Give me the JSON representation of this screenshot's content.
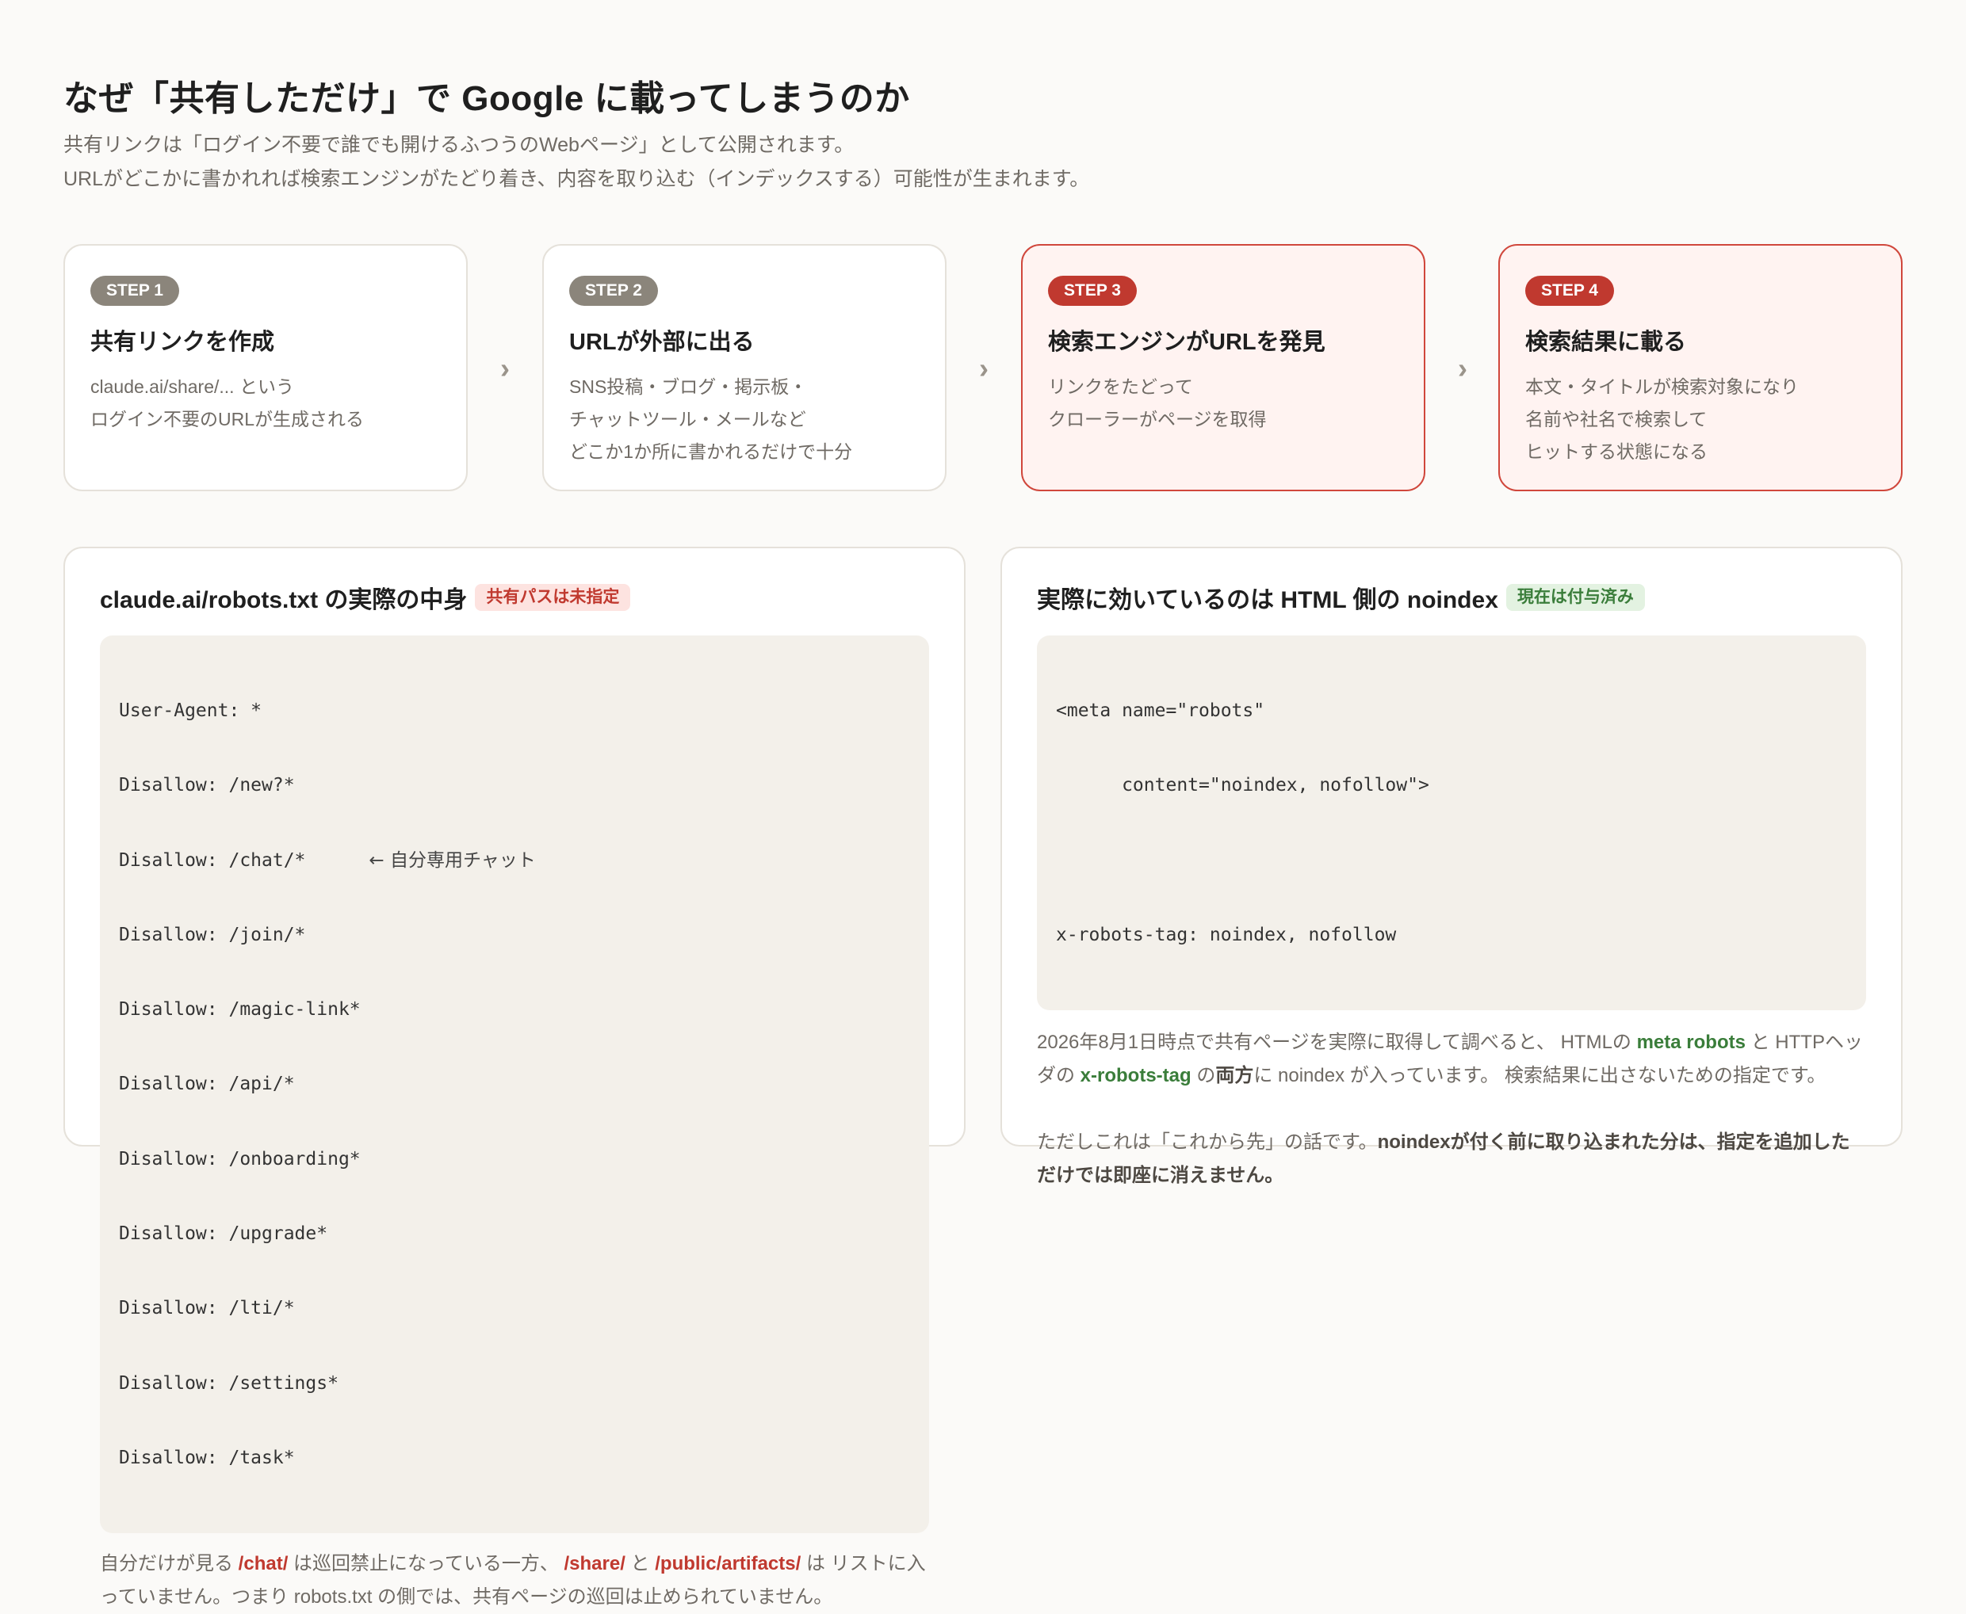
{
  "header": {
    "title": "なぜ「共有しただけ」で Google に載ってしまうのか",
    "subtitle_line1": "共有リンクは「ログイン不要で誰でも開けるふつうのWebページ」として公開されます。",
    "subtitle_line2": "URLがどこかに書かれれば検索エンジンがたどり着き、内容を取り込む（インデックスする）可能性が生まれます。"
  },
  "steps": [
    {
      "badge": "STEP 1",
      "title": "共有リンクを作成",
      "desc": [
        "claude.ai/share/... という",
        "ログイン不要のURLが生成される"
      ]
    },
    {
      "badge": "STEP 2",
      "title": "URLが外部に出る",
      "desc": [
        "SNS投稿・ブログ・掲示板・",
        "チャットツール・メールなど",
        "どこか1か所に書かれるだけで十分"
      ]
    },
    {
      "badge": "STEP 3",
      "title": "検索エンジンがURLを発見",
      "desc": [
        "リンクをたどって",
        "クローラーがページを取得"
      ]
    },
    {
      "badge": "STEP 4",
      "title": "検索結果に載る",
      "desc": [
        "本文・タイトルが検索対象になり",
        "名前や社名で検索して",
        "ヒットする状態になる"
      ]
    }
  ],
  "arrow_glyph": "›",
  "colors": {
    "accent_red": "#c0392f",
    "accent_green": "#3a7d3a",
    "badge_gray": "#8b857b"
  },
  "robots_panel": {
    "title": "claude.ai/robots.txt の実際の中身",
    "tag": "共有パスは未指定",
    "code": [
      "User-Agent: *",
      "Disallow: /new?*",
      "Disallow: /chat/*",
      "Disallow: /join/*",
      "Disallow: /magic-link*",
      "Disallow: /api/*",
      "Disallow: /onboarding*",
      "Disallow: /upgrade*",
      "Disallow: /lti/*",
      "Disallow: /settings*",
      "Disallow: /task*"
    ],
    "chat_note": "← 自分専用チャット",
    "foot": {
      "t1": "自分だけが見る ",
      "chat": "/chat/",
      "t2": " は巡回禁止になっている一方、 ",
      "share": "/share/",
      "t3": " と ",
      "artifacts": "/public/artifacts/",
      "t4": " は リストに入っていません。つまり robots.txt の側では、共有ページの巡回は止められていません。"
    }
  },
  "noindex_panel": {
    "title": "実際に効いているのは HTML 側の noindex",
    "tag": "現在は付与済み",
    "code": [
      "<meta name=\"robots\"",
      "      content=\"noindex, nofollow\">",
      "",
      "x-robots-tag: noindex, nofollow"
    ],
    "p1": {
      "t1": "2026年8月1日時点で共有ページを実際に取得して調べると、 HTMLの ",
      "meta": "meta robots",
      "t2": " と HTTPヘッダの ",
      "xrt": "x-robots-tag",
      "t3": " の",
      "both": "両方",
      "t4": "に noindex が入っています。 検索結果に出さないための指定です。"
    },
    "p2": {
      "t1": "ただしこれは「これから先」の話です。",
      "strong": "noindexが付く前に取り込まれた分は、指定を追加しただけでは即座に消えません。"
    }
  }
}
